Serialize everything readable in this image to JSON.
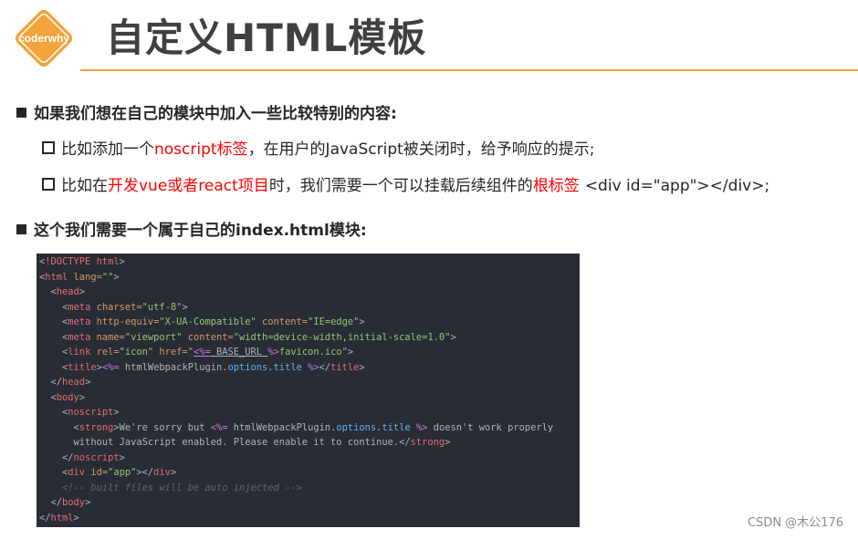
{
  "header": {
    "logo_text": "coderwhy",
    "title": "自定义HTML模板"
  },
  "bullets": [
    {
      "text": "如果我们想在自己的模块中加入一些比较特别的内容:"
    },
    {
      "parts": [
        "比如添加一个",
        "noscript标签",
        "，在用户的JavaScript被关闭时，给予响应的提示;"
      ]
    },
    {
      "parts": [
        "比如在",
        "开发vue或者react项目",
        "时，我们需要一个可以挂载后续组件的",
        "根标签",
        "<div id=\"app\"></div>;"
      ]
    },
    {
      "text": "这个我们需要一个属于自己的index.html模块:"
    }
  ],
  "code": {
    "l1": [
      "<",
      "!DOCTYPE html",
      ">"
    ],
    "l2": [
      "<",
      "html",
      " lang=",
      "\"\"",
      ">"
    ],
    "l3": [
      "<",
      "head",
      ">"
    ],
    "l4": [
      "<",
      "meta",
      " charset=",
      "\"utf-8\"",
      ">"
    ],
    "l5": [
      "<",
      "meta",
      " http-equiv=",
      "\"X-UA-Compatible\"",
      " content=",
      "\"IE=edge\"",
      ">"
    ],
    "l6": [
      "<",
      "meta",
      " name=",
      "\"viewport\"",
      " content=",
      "\"width=device-width,initial-scale=1.0\"",
      ">"
    ],
    "l7": [
      "<",
      "link",
      " rel=",
      "\"icon\"",
      " href=",
      "\"",
      "<%=",
      " BASE_URL ",
      "%>",
      "favicon.ico",
      "\"",
      ">"
    ],
    "l8": [
      "<",
      "title",
      ">",
      "<%=",
      " htmlWebpackPlugin.",
      "options",
      ".",
      "title",
      " %>",
      "</",
      "title",
      ">"
    ],
    "l9": [
      "</",
      "head",
      ">"
    ],
    "l10": [
      "<",
      "body",
      ">"
    ],
    "l11": [
      "<",
      "noscript",
      ">"
    ],
    "l12": [
      "<",
      "strong",
      ">",
      "We're sorry but ",
      "<%=",
      " htmlWebpackPlugin.",
      "options",
      ".",
      "title",
      " %>",
      " doesn't work properly"
    ],
    "l13": [
      "without JavaScript enabled. Please enable it to continue.",
      "</",
      "strong",
      ">"
    ],
    "l14": [
      "</",
      "noscript",
      ">"
    ],
    "l15": [
      "<",
      "div",
      " id=",
      "\"app\"",
      "></",
      "div",
      ">"
    ],
    "l16": [
      "<!-- built files will be auto injected -->"
    ],
    "l17": [
      "</",
      "body",
      ">"
    ],
    "l18": [
      "</",
      "html",
      ">"
    ]
  },
  "watermark": "CSDN @木公176",
  "colors": {
    "accent_orange": "#f2a33a",
    "highlight_red": "#ff0000",
    "code_bg": "#282c34"
  }
}
